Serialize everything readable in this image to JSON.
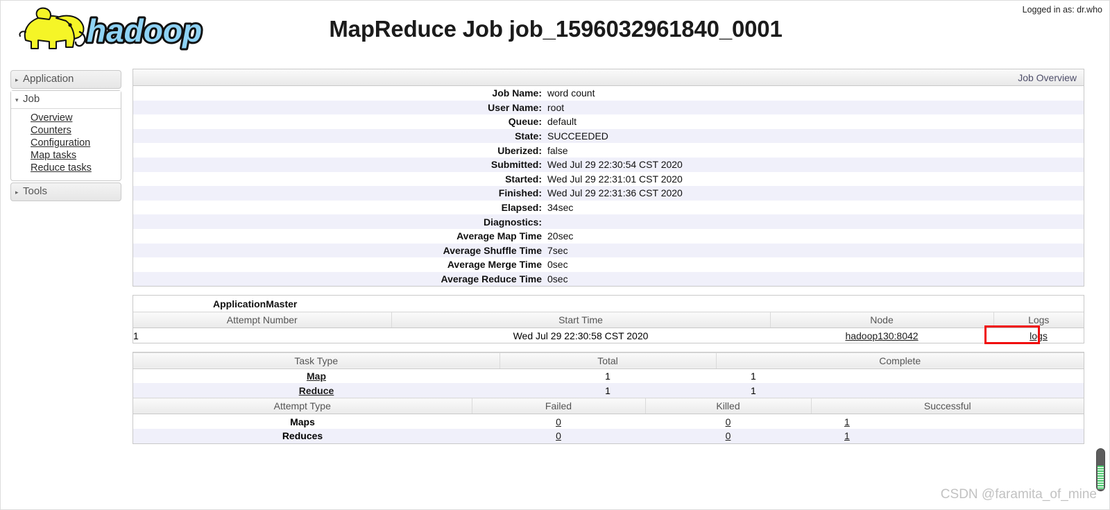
{
  "header": {
    "title": "MapReduce Job job_1596032961840_0001",
    "logged_in": "Logged in as: dr.who",
    "logo_alt": "hadoop-logo"
  },
  "sidebar": {
    "groups": [
      {
        "label": "Application",
        "caret": "▸",
        "expanded": false,
        "items": []
      },
      {
        "label": "Job",
        "caret": "▾",
        "expanded": true,
        "items": [
          "Overview",
          "Counters",
          "Configuration",
          "Map tasks",
          "Reduce tasks"
        ]
      },
      {
        "label": "Tools",
        "caret": "▸",
        "expanded": false,
        "items": []
      }
    ]
  },
  "job_overview": {
    "panel_title": "Job Overview",
    "rows": [
      {
        "label": "Job Name:",
        "value": "word count"
      },
      {
        "label": "User Name:",
        "value": "root"
      },
      {
        "label": "Queue:",
        "value": "default"
      },
      {
        "label": "State:",
        "value": "SUCCEEDED"
      },
      {
        "label": "Uberized:",
        "value": "false"
      },
      {
        "label": "Submitted:",
        "value": "Wed Jul 29 22:30:54 CST 2020"
      },
      {
        "label": "Started:",
        "value": "Wed Jul 29 22:31:01 CST 2020"
      },
      {
        "label": "Finished:",
        "value": "Wed Jul 29 22:31:36 CST 2020"
      },
      {
        "label": "Elapsed:",
        "value": "34sec"
      },
      {
        "label": "Diagnostics:",
        "value": ""
      },
      {
        "label": "Average Map Time",
        "value": "20sec"
      },
      {
        "label": "Average Shuffle Time",
        "value": "7sec"
      },
      {
        "label": "Average Merge Time",
        "value": "0sec"
      },
      {
        "label": "Average Reduce Time",
        "value": "0sec"
      }
    ]
  },
  "application_master": {
    "caption": "ApplicationMaster",
    "columns": [
      "Attempt Number",
      "Start Time",
      "Node",
      "Logs"
    ],
    "rows": [
      {
        "attempt_number": "1",
        "start_time": "Wed Jul 29 22:30:58 CST 2020",
        "node": "hadoop130:8042",
        "logs": "logs"
      }
    ],
    "annotation_color": "#f00a0a"
  },
  "task_table": {
    "columns": [
      "Task Type",
      "Total",
      "Complete"
    ],
    "rows": [
      {
        "task_type": "Map",
        "total": "1",
        "complete": "1"
      },
      {
        "task_type": "Reduce",
        "total": "1",
        "complete": "1"
      }
    ]
  },
  "attempt_table": {
    "columns": [
      "Attempt Type",
      "Failed",
      "Killed",
      "Successful"
    ],
    "rows": [
      {
        "attempt_type": "Maps",
        "failed": "0",
        "killed": "0",
        "successful": "1"
      },
      {
        "attempt_type": "Reduces",
        "failed": "0",
        "killed": "0",
        "successful": "1"
      }
    ]
  },
  "watermark": "CSDN @faramita_of_mine"
}
